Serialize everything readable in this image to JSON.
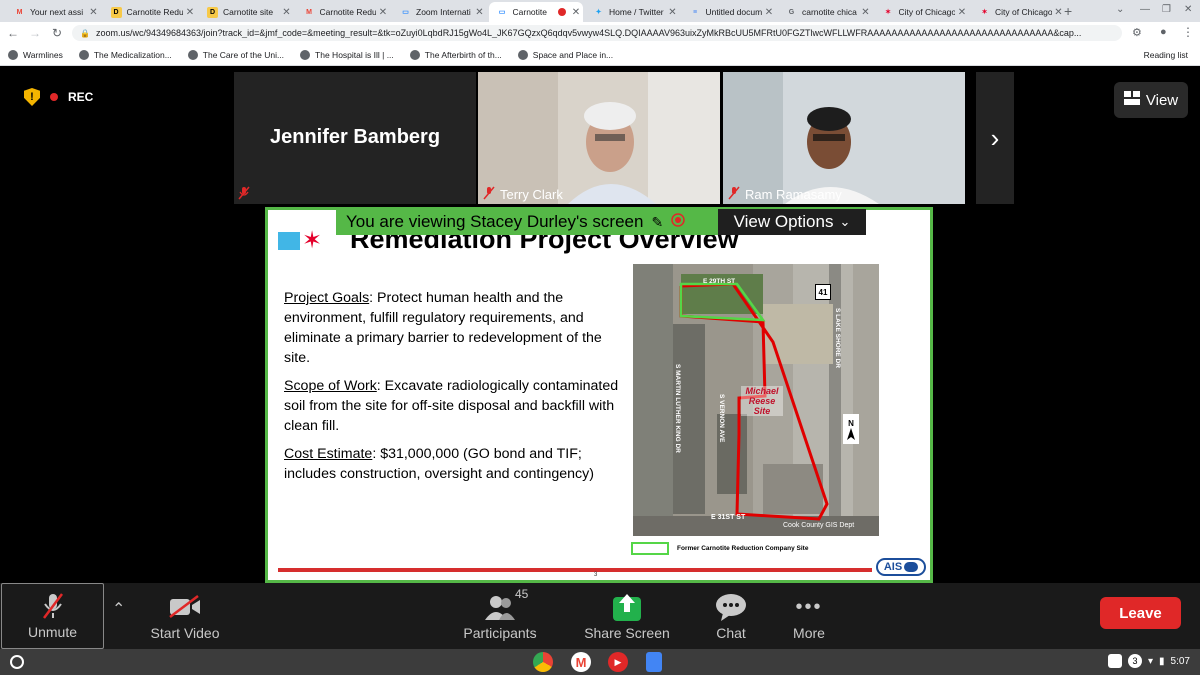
{
  "browser": {
    "tabs": [
      {
        "label": "Your next assi",
        "icon": "gmail-icon",
        "fav_text": "M",
        "fav_color": "#ea4335"
      },
      {
        "label": "Carnotite Redu",
        "icon": "doc-icon",
        "fav_text": "D",
        "fav_color": "#f7c948"
      },
      {
        "label": "Carnotite site",
        "icon": "doc-icon",
        "fav_text": "D",
        "fav_color": "#f7c948"
      },
      {
        "label": "Carnotite Redu",
        "icon": "gmail-icon",
        "fav_text": "M",
        "fav_color": "#ea4335"
      },
      {
        "label": "Zoom Internati",
        "icon": "zoom-icon",
        "fav_text": "▭",
        "fav_color": "#2d8cff"
      },
      {
        "label": "Carnotite",
        "icon": "zoom-icon",
        "fav_text": "▭",
        "fav_color": "#2d8cff"
      },
      {
        "label": "Home / Twitter",
        "icon": "twitter-icon",
        "fav_text": "✦",
        "fav_color": "#1da1f2"
      },
      {
        "label": "Untitled docum",
        "icon": "gdocs-icon",
        "fav_text": "≡",
        "fav_color": "#4285f4"
      },
      {
        "label": "carnotite chica",
        "icon": "google-icon",
        "fav_text": "G",
        "fav_color": "#5f6368"
      },
      {
        "label": "City of Chicago",
        "icon": "chicago-star-icon",
        "fav_text": "✶",
        "fav_color": "#e4002b"
      },
      {
        "label": "City of Chicago",
        "icon": "chicago-star-icon",
        "fav_text": "✶",
        "fav_color": "#e4002b"
      }
    ],
    "url": "zoom.us/wc/94349684363/join?track_id=&jmf_code=&meeting_result=&tk=oZuyi0LqbdRJ15gWo4L_JK67GQzxQ6qdqv5vwyw4SLQ.DQIAAAAV963uixZyMkRBcUU5MFRtU0FGZTlwcWFLLWFRAAAAAAAAAAAAAAAAAAAAAAAAAAAAAAA&cap...",
    "bookmarks": [
      "Warmlines",
      "The Medicalization...",
      "The Care of the Uni...",
      "The Hospital is Ill | ...",
      "The Afterbirth of th...",
      "Space and Place in..."
    ],
    "reading_list": "Reading list"
  },
  "meeting": {
    "rec_label": "REC",
    "view_label": "View",
    "featured_name": "Jennifer Bamberg",
    "participants": [
      {
        "name": "Terry Clark"
      },
      {
        "name": "Ram Ramasamy"
      }
    ],
    "banner_text": "You are viewing Stacey Durley's screen",
    "view_options_label": "View Options"
  },
  "slide": {
    "title": "Remediation Project Overview",
    "goals_heading": "Project Goals",
    "goals_text": ": Protect human health and the environment, fulfill regulatory requirements, and eliminate a primary barrier to redevelopment of the site.",
    "scope_heading": "Scope of Work",
    "scope_text": ": Excavate radiologically contaminated soil from the site for off-site disposal and backfill with clean fill.",
    "cost_heading": "Cost Estimate",
    "cost_text": ": $31,000,000  (GO bond and TIF; includes construction, oversight and contingency)",
    "map_labels": {
      "site": "Michael\nReese\nSite",
      "street_top": "E 29TH ST",
      "street_bottom": "E 31ST ST",
      "street_left": "S MARTIN LUTHER KING DR",
      "street_mid": "S VERNON AVE",
      "street_right": "S LAKE SHORE DR",
      "credit": "Cook County GIS Dept",
      "route": "41",
      "north": "N"
    },
    "legend_text": "Former Carnotite Reduction Company Site",
    "page_number": "3",
    "ais_logo": "AIS"
  },
  "toolbar": {
    "unmute": "Unmute",
    "start_video": "Start Video",
    "participants": "Participants",
    "participants_count": "45",
    "share_screen": "Share Screen",
    "chat": "Chat",
    "more": "More",
    "leave": "Leave"
  },
  "shelf": {
    "notification_count": "3",
    "time": "5:07"
  }
}
